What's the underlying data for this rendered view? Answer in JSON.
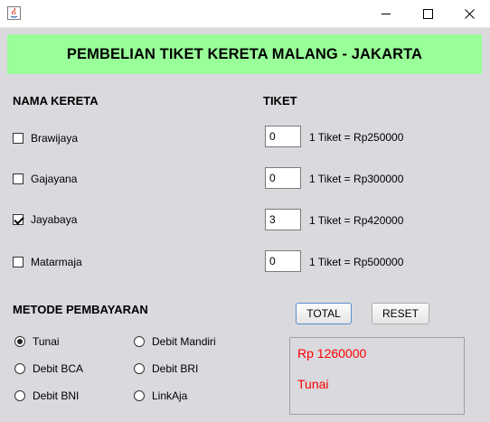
{
  "window": {
    "icon": "java-icon",
    "controls": [
      "minimize-icon",
      "maximize-icon",
      "close-icon"
    ]
  },
  "header": {
    "title": "PEMBELIAN TIKET KERETA MALANG - JAKARTA",
    "background": "#99ff99"
  },
  "trains": {
    "label": "NAMA KERETA",
    "items": [
      {
        "name": "Brawijaya",
        "checked": false
      },
      {
        "name": "Gajayana",
        "checked": false
      },
      {
        "name": "Jayabaya",
        "checked": true
      },
      {
        "name": "Matarmaja",
        "checked": false
      }
    ]
  },
  "tickets": {
    "label": "TIKET",
    "items": [
      {
        "qty": "0",
        "price": "1 Tiket = Rp250000"
      },
      {
        "qty": "0",
        "price": "1 Tiket = Rp300000"
      },
      {
        "qty": "3",
        "price": "1 Tiket = Rp420000"
      },
      {
        "qty": "0",
        "price": "1 Tiket = Rp500000"
      }
    ]
  },
  "payment": {
    "label": "METODE PEMBAYARAN",
    "options": [
      {
        "label": "Tunai",
        "selected": true
      },
      {
        "label": "Debit Mandiri",
        "selected": false
      },
      {
        "label": "Debit BCA",
        "selected": false
      },
      {
        "label": "Debit BRI",
        "selected": false
      },
      {
        "label": "Debit BNI",
        "selected": false
      },
      {
        "label": "LinkAja",
        "selected": false
      }
    ]
  },
  "actions": {
    "total_label": "TOTAL",
    "reset_label": "RESET"
  },
  "result": {
    "total": "Rp  1260000",
    "method": "Tunai",
    "text_color": "#ff0000"
  }
}
